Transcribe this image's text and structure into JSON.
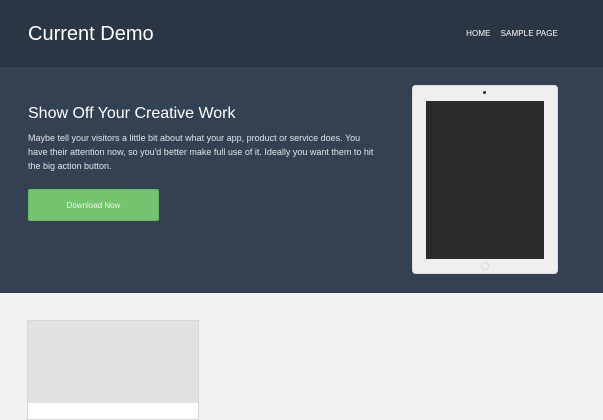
{
  "header": {
    "site_title": "Current Demo",
    "nav": [
      {
        "label": "HOME"
      },
      {
        "label": "SAMPLE PAGE"
      }
    ]
  },
  "hero": {
    "title": "Show Off Your Creative Work",
    "description": "Maybe tell your visitors a little bit about what your app, product or service does. You have their attention now, so you'd better make full use of it. Ideally you want them to hit the big action button.",
    "cta_label": "Download Now"
  },
  "colors": {
    "header_bg": "#2b3645",
    "hero_bg": "#344152",
    "cta_bg": "#74c36f",
    "page_bg": "#f1f1f2"
  }
}
